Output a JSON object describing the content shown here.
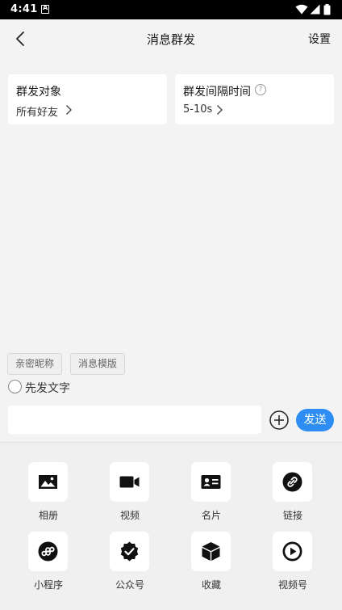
{
  "status_bar": {
    "time": "4:41"
  },
  "header": {
    "title": "消息群发",
    "settings_label": "设置"
  },
  "cards": {
    "target": {
      "title": "群发对象",
      "value": "所有好友"
    },
    "interval": {
      "title": "群发间隔时间",
      "value": "5-10s"
    }
  },
  "tags": [
    "亲密昵称",
    "消息模版"
  ],
  "radio": {
    "label": "先发文字",
    "checked": false
  },
  "composer": {
    "value": "",
    "placeholder": "",
    "send_label": "发送"
  },
  "attachments": [
    {
      "label": "相册",
      "icon": "album-icon"
    },
    {
      "label": "视频",
      "icon": "video-icon"
    },
    {
      "label": "名片",
      "icon": "card-icon"
    },
    {
      "label": "链接",
      "icon": "link-icon"
    },
    {
      "label": "小程序",
      "icon": "mini-program-icon"
    },
    {
      "label": "公众号",
      "icon": "official-account-icon"
    },
    {
      "label": "收藏",
      "icon": "favorites-icon"
    },
    {
      "label": "视频号",
      "icon": "channels-icon"
    }
  ]
}
